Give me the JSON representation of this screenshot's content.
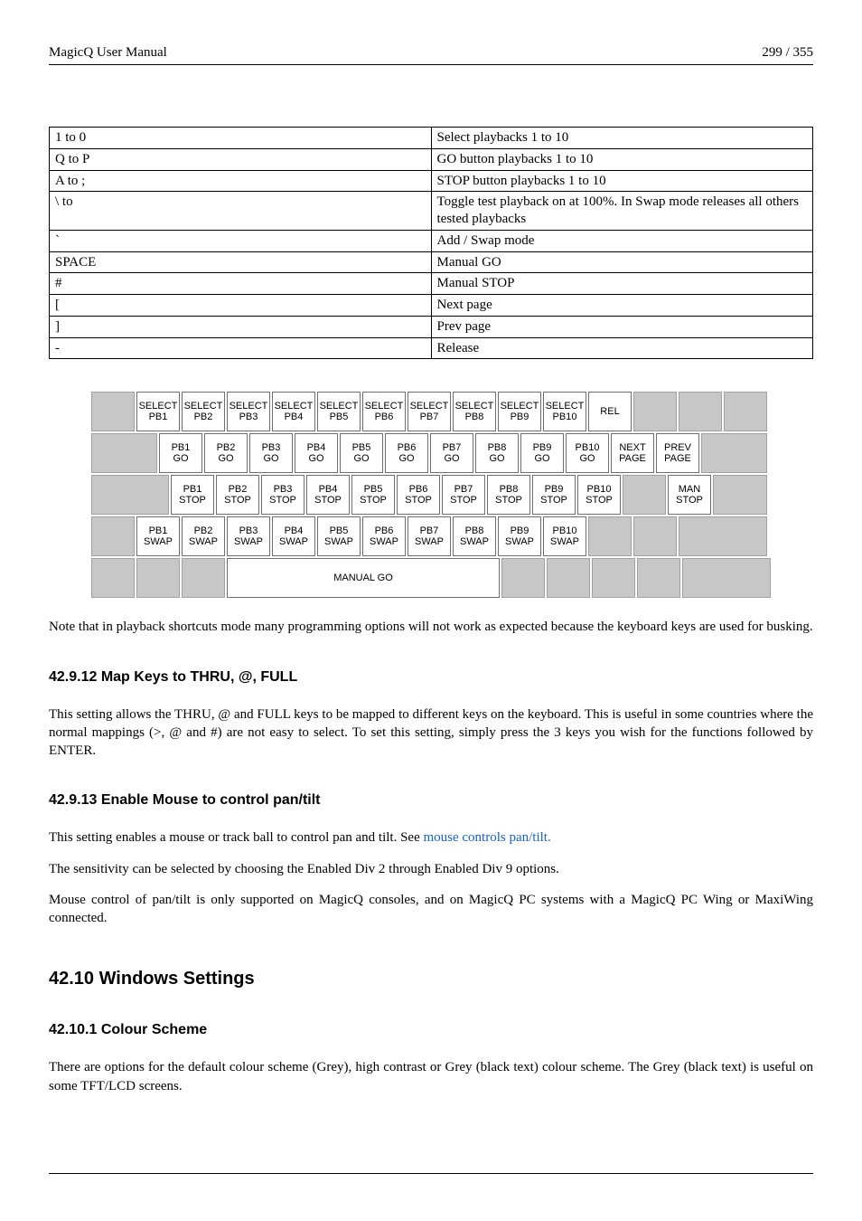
{
  "header": {
    "left": "MagicQ User Manual",
    "right": "299 / 355"
  },
  "shortcuts": [
    {
      "key": "1 to 0",
      "desc": "Select playbacks 1 to 10"
    },
    {
      "key": "Q to P",
      "desc": "GO button playbacks 1 to 10"
    },
    {
      "key": "A to ;",
      "desc": "STOP button playbacks 1 to 10"
    },
    {
      "key": "\\ to",
      "desc": "Toggle test playback on at 100%. In Swap mode releases all others tested playbacks"
    },
    {
      "key": "`",
      "desc": "Add / Swap mode"
    },
    {
      "key": "SPACE",
      "desc": "Manual GO"
    },
    {
      "key": "#",
      "desc": "Manual STOP"
    },
    {
      "key": "[",
      "desc": "Next page"
    },
    {
      "key": "]",
      "desc": "Prev page"
    },
    {
      "key": "-",
      "desc": "Release"
    }
  ],
  "kbd": {
    "row_select": [
      "SELECT PB1",
      "SELECT PB2",
      "SELECT PB3",
      "SELECT PB4",
      "SELECT PB5",
      "SELECT PB6",
      "SELECT PB7",
      "SELECT PB8",
      "SELECT PB9",
      "SELECT PB10",
      "REL"
    ],
    "row_go_labels": [
      "PB1",
      "PB2",
      "PB3",
      "PB4",
      "PB5",
      "PB6",
      "PB7",
      "PB8",
      "PB9",
      "PB10",
      "NEXT",
      "PREV"
    ],
    "row_go_line2": [
      "GO",
      "GO",
      "GO",
      "GO",
      "GO",
      "GO",
      "GO",
      "GO",
      "GO",
      "GO",
      "PAGE",
      "PAGE"
    ],
    "row_stop_labels": [
      "PB1",
      "PB2",
      "PB3",
      "PB4",
      "PB5",
      "PB6",
      "PB7",
      "PB8",
      "PB9",
      "PB10",
      "",
      "MAN"
    ],
    "row_stop_line2": [
      "STOP",
      "STOP",
      "STOP",
      "STOP",
      "STOP",
      "STOP",
      "STOP",
      "STOP",
      "STOP",
      "STOP",
      "",
      "STOP"
    ],
    "row_swap_labels": [
      "PB1",
      "PB2",
      "PB3",
      "PB4",
      "PB5",
      "PB6",
      "PB7",
      "PB8",
      "PB9",
      "PB10"
    ],
    "row_swap_line2": [
      "SWAP",
      "SWAP",
      "SWAP",
      "SWAP",
      "SWAP",
      "SWAP",
      "SWAP",
      "SWAP",
      "SWAP",
      "SWAP"
    ],
    "manual_go": "MANUAL GO"
  },
  "para_after_kbd": "Note that in playback shortcuts mode many programming options will not work as expected because the keyboard keys are used for busking.",
  "sec_42_9_12": {
    "heading": "42.9.12   Map Keys to THRU, @, FULL",
    "body": "This setting allows the THRU, @ and FULL keys to be mapped to different keys on the keyboard. This is useful in some countries where the normal mappings (>, @ and #) are not easy to select. To set this setting, simply press the 3 keys you wish for the functions followed by ENTER."
  },
  "sec_42_9_13": {
    "heading": "42.9.13   Enable Mouse to control pan/tilt",
    "line1_pre": "This setting enables a mouse or track ball to control pan and tilt. See ",
    "line1_link": "mouse controls pan/tilt.",
    "line2": "The sensitivity can be selected by choosing the Enabled Div 2 through Enabled Div 9 options.",
    "line3": "Mouse control of pan/tilt is only supported on MagicQ consoles, and on MagicQ PC systems with a MagicQ PC Wing or MaxiWing connected."
  },
  "sec_42_10": {
    "heading": "42.10   Windows Settings"
  },
  "sec_42_10_1": {
    "heading": "42.10.1   Colour Scheme",
    "body": "There are options for the default colour scheme (Grey), high contrast or Grey (black text) colour scheme. The Grey (black text) is useful on some TFT/LCD screens."
  }
}
